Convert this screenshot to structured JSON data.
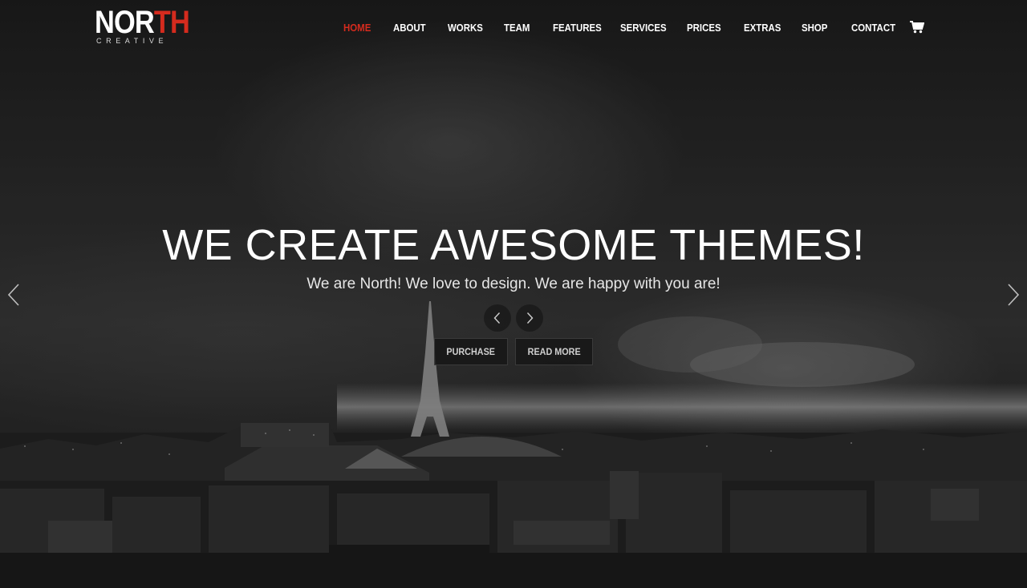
{
  "brand": {
    "logo_main_prefix": "NOR",
    "logo_main_accent": "TH",
    "logo_sub": "CREATIVE",
    "accent_color": "#d52b1e"
  },
  "nav": {
    "items": [
      {
        "label": "HOME",
        "active": true
      },
      {
        "label": "ABOUT",
        "active": false
      },
      {
        "label": "WORKS",
        "active": false
      },
      {
        "label": "TEAM",
        "active": false
      },
      {
        "label": "FEATURES",
        "active": false
      },
      {
        "label": "SERVICES",
        "active": false
      },
      {
        "label": "PRICES",
        "active": false
      },
      {
        "label": "EXTRAS",
        "active": false
      },
      {
        "label": "SHOP",
        "active": false
      },
      {
        "label": "CONTACT",
        "active": false
      }
    ],
    "cart_icon": "shopping-cart-icon"
  },
  "hero": {
    "headline": "WE CREATE AWESOME THEMES!",
    "subline": "We are North! We love to design. We are happy with you are!",
    "buttons": {
      "purchase": "PURCHASE",
      "read_more": "READ MORE"
    },
    "mini_arrows": {
      "prev_icon": "chevron-left-icon",
      "next_icon": "chevron-right-icon"
    },
    "slider_arrows": {
      "prev_icon": "chevron-left-icon",
      "next_icon": "chevron-right-icon"
    }
  }
}
